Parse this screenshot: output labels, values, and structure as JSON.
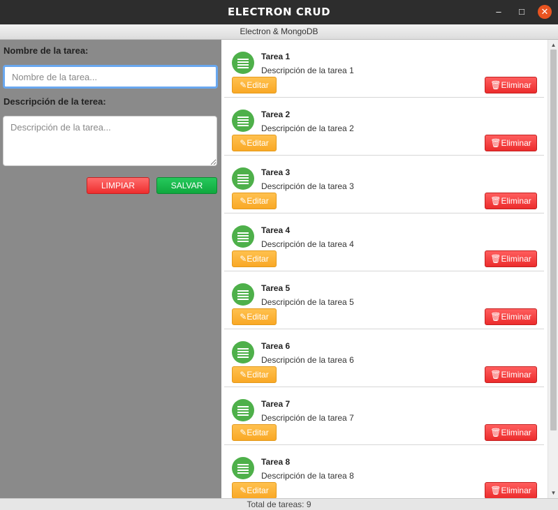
{
  "window": {
    "title": "ELECTRON CRUD",
    "minimize": "–",
    "maximize": "□",
    "close": "✕"
  },
  "subtitle": "Electron & MongoDB",
  "form": {
    "name_label": "Nombre de la tarea:",
    "name_placeholder": "Nombre de la tarea...",
    "desc_label": "Descripción de la terea:",
    "desc_placeholder": "Descripción de la tarea...",
    "clear_label": "LIMPIAR",
    "save_label": "SALVAR"
  },
  "task_icon": "list-icon",
  "edit_icon": "pencil-icon",
  "delete_icon": "trash-icon",
  "tasks": [
    {
      "name": "Tarea 1",
      "description": "Descripción de la tarea 1",
      "edit_label": "Editar",
      "delete_label": "Eliminar"
    },
    {
      "name": "Tarea 2",
      "description": "Descripción de la tarea 2",
      "edit_label": "Editar",
      "delete_label": "Eliminar"
    },
    {
      "name": "Tarea 3",
      "description": "Descripción de la tarea 3",
      "edit_label": "Editar",
      "delete_label": "Eliminar"
    },
    {
      "name": "Tarea 4",
      "description": "Descripción de la tarea 4",
      "edit_label": "Editar",
      "delete_label": "Eliminar"
    },
    {
      "name": "Tarea 5",
      "description": "Descripción de la tarea 5",
      "edit_label": "Editar",
      "delete_label": "Eliminar"
    },
    {
      "name": "Tarea 6",
      "description": "Descripción de la tarea 6",
      "edit_label": "Editar",
      "delete_label": "Eliminar"
    },
    {
      "name": "Tarea 7",
      "description": "Descripción de la tarea 7",
      "edit_label": "Editar",
      "delete_label": "Eliminar"
    },
    {
      "name": "Tarea 8",
      "description": "Descripción de la tarea 8",
      "edit_label": "Editar",
      "delete_label": "Eliminar"
    }
  ],
  "footer": "Total de tareas: 9",
  "colors": {
    "accent_green": "#4eb04a",
    "edit_orange": "#f9a825",
    "delete_red": "#ec2c2c",
    "save_green": "#10a83e"
  }
}
